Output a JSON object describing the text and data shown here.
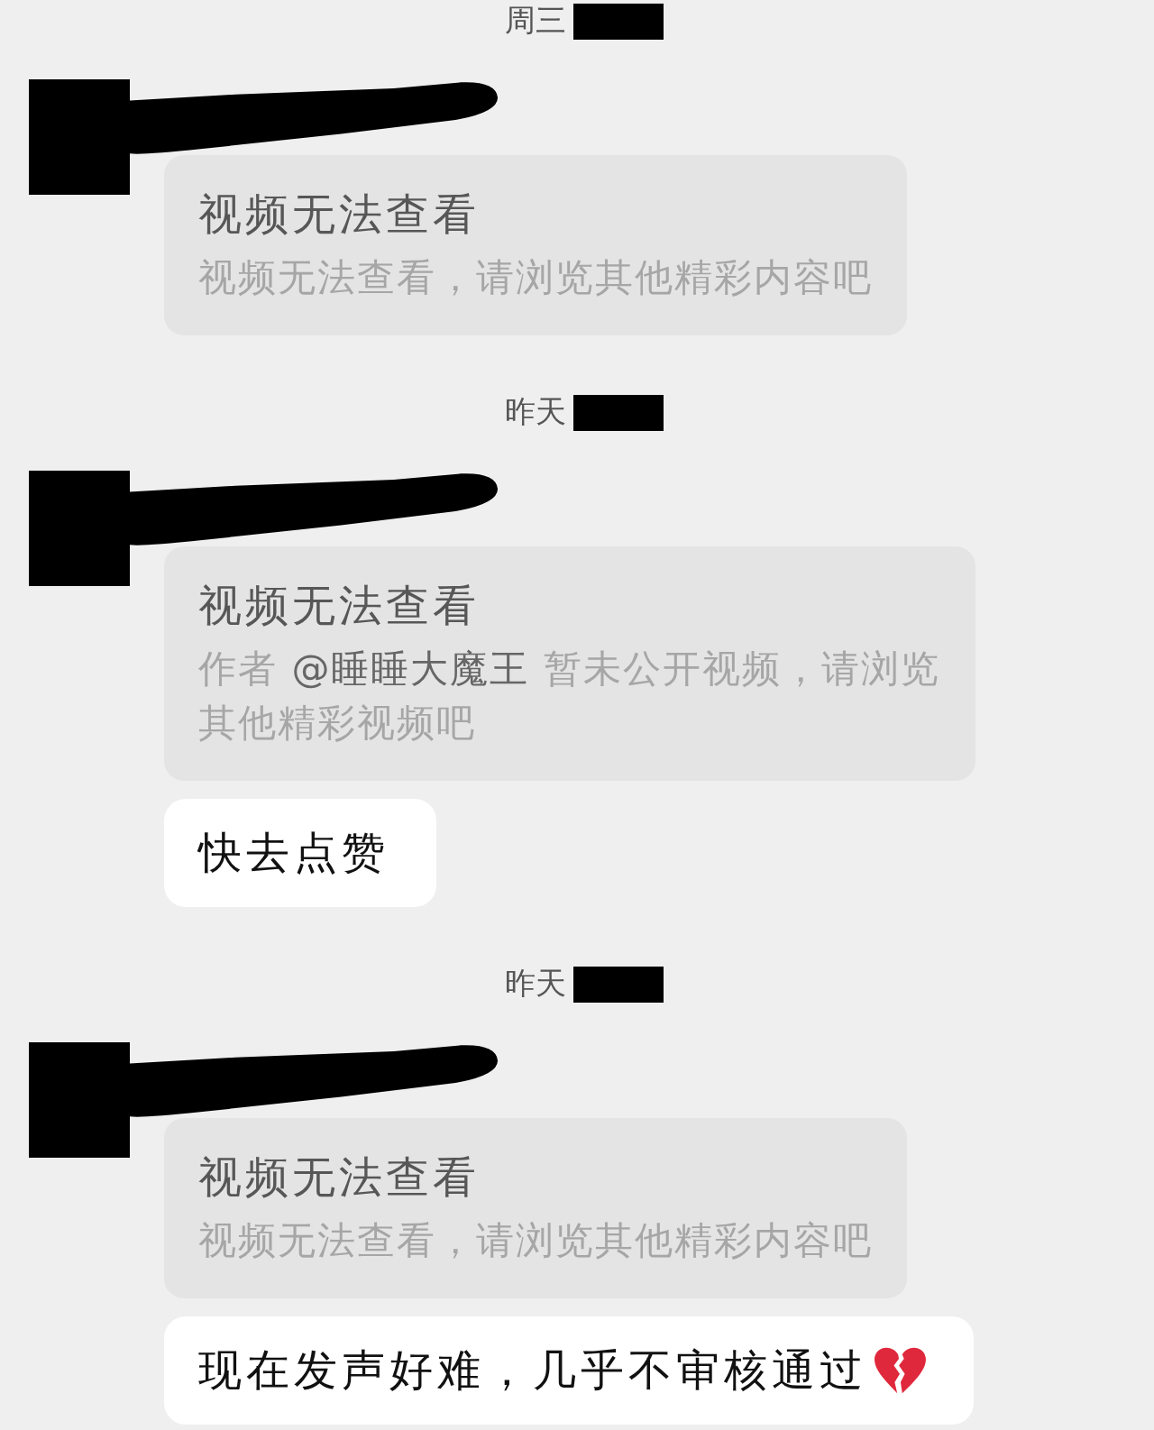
{
  "chat": [
    {
      "kind": "timestamp",
      "label": "周三"
    },
    {
      "kind": "message",
      "contents": [
        {
          "kind": "video_card",
          "title": "视频无法查看",
          "description": [
            {
              "kind": "text",
              "text": "视频无法查看，请浏览其他精彩内容吧"
            }
          ]
        }
      ]
    },
    {
      "kind": "timestamp",
      "label": "昨天"
    },
    {
      "kind": "message",
      "contents": [
        {
          "kind": "video_card",
          "title": "视频无法查看",
          "description": [
            {
              "kind": "text",
              "text": "作者 "
            },
            {
              "kind": "mention",
              "text": "@睡睡大魔王"
            },
            {
              "kind": "text",
              "text": " 暂未公开视频，请浏览其他精彩视频吧"
            }
          ]
        },
        {
          "kind": "text_bubble",
          "parts": [
            {
              "kind": "text",
              "text": "快去点赞"
            }
          ]
        }
      ]
    },
    {
      "kind": "timestamp",
      "label": "昨天"
    },
    {
      "kind": "message",
      "contents": [
        {
          "kind": "video_card",
          "title": "视频无法查看",
          "description": [
            {
              "kind": "text",
              "text": "视频无法查看，请浏览其他精彩内容吧"
            }
          ]
        },
        {
          "kind": "text_bubble",
          "parts": [
            {
              "kind": "text",
              "text": "现在发声好难，几乎不审核通过"
            },
            {
              "kind": "broken_heart"
            }
          ]
        }
      ]
    }
  ]
}
